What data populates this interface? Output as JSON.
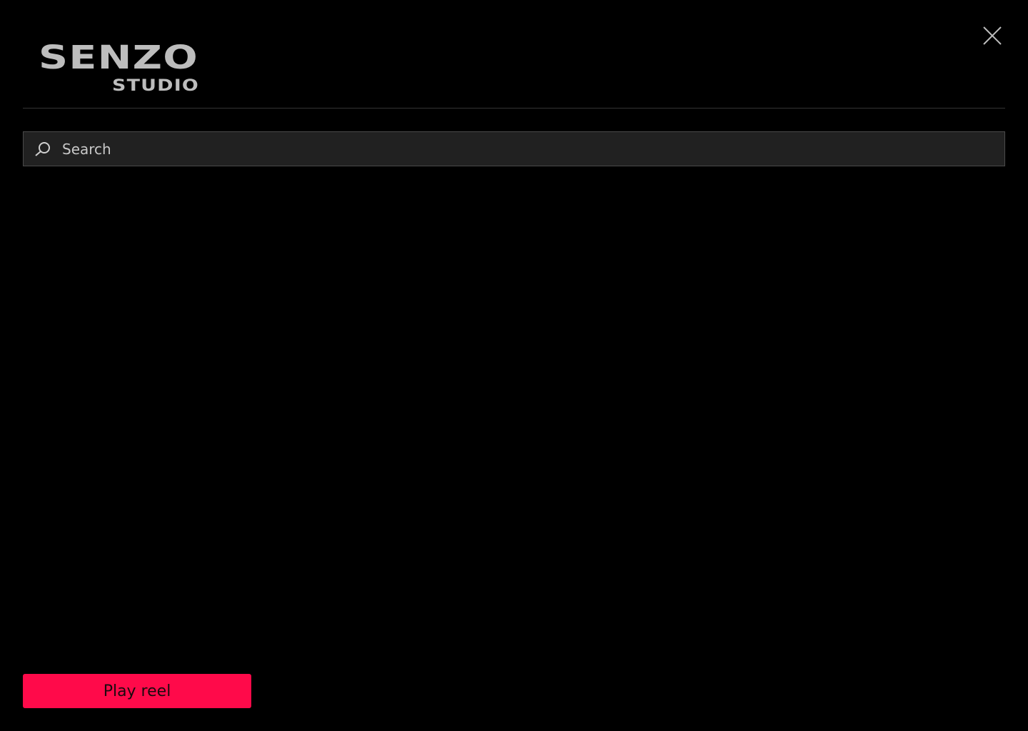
{
  "logo": {
    "word1": "SENZO",
    "word2": "STUDIO"
  },
  "close": {
    "icon": "close-icon"
  },
  "search": {
    "icon": "search-icon",
    "placeholder": "Search",
    "value": ""
  },
  "play_reel": {
    "label": "Play reel"
  },
  "colors": {
    "background": "#000000",
    "accent": "#ff0a4a",
    "logo_text": "#bdbdbd",
    "search_bg": "#212121",
    "divider": "#333333"
  }
}
